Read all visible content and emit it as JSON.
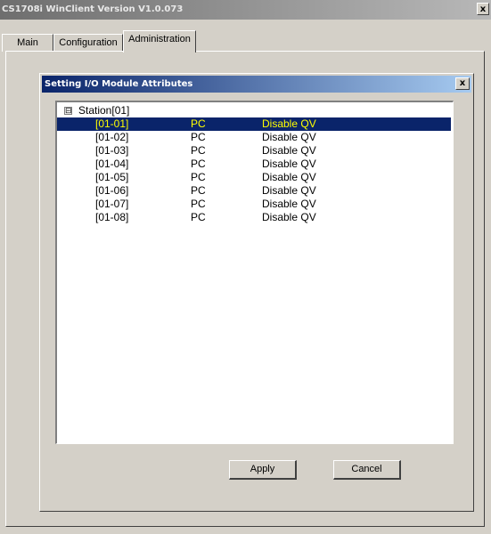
{
  "window": {
    "title": "CS1708i WinClient Version V1.0.073",
    "close_label": "x"
  },
  "tabs": [
    {
      "label": "Main"
    },
    {
      "label": "Configuration"
    },
    {
      "label": "Administration"
    }
  ],
  "dialog": {
    "title": "Setting I/O Module Attributes",
    "close_label": "x",
    "tree": {
      "expander": "⊟",
      "root_label": "Station[01]",
      "rows": [
        {
          "port": "[01-01]",
          "type": "PC",
          "qv": "Disable QV",
          "selected": true
        },
        {
          "port": "[01-02]",
          "type": "PC",
          "qv": "Disable QV"
        },
        {
          "port": "[01-03]",
          "type": "PC",
          "qv": "Disable QV"
        },
        {
          "port": "[01-04]",
          "type": "PC",
          "qv": "Disable QV"
        },
        {
          "port": "[01-05]",
          "type": "PC",
          "qv": "Disable QV"
        },
        {
          "port": "[01-06]",
          "type": "PC",
          "qv": "Disable QV"
        },
        {
          "port": "[01-07]",
          "type": "PC",
          "qv": "Disable QV"
        },
        {
          "port": "[01-08]",
          "type": "PC",
          "qv": "Disable QV"
        }
      ]
    },
    "buttons": {
      "apply": "Apply",
      "cancel": "Cancel"
    }
  },
  "colors": {
    "selection_bg": "#0a246a",
    "selection_fg": "#ffff00",
    "face": "#d4d0c8"
  }
}
